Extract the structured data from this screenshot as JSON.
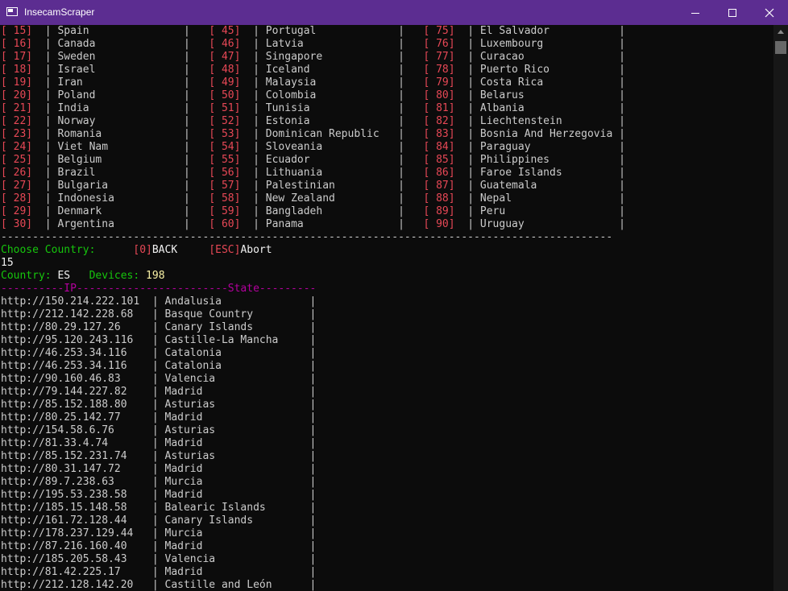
{
  "window": {
    "title": "InsecamScraper"
  },
  "countries": [
    [
      "15",
      "Spain",
      "45",
      "Portugal",
      "75",
      "El Salvador"
    ],
    [
      "16",
      "Canada",
      "46",
      "Latvia",
      "76",
      "Luxembourg"
    ],
    [
      "17",
      "Sweden",
      "47",
      "Singapore",
      "77",
      "Curacao"
    ],
    [
      "18",
      "Israel",
      "48",
      "Iceland",
      "78",
      "Puerto Rico"
    ],
    [
      "19",
      "Iran",
      "49",
      "Malaysia",
      "79",
      "Costa Rica"
    ],
    [
      "20",
      "Poland",
      "50",
      "Colombia",
      "80",
      "Belarus"
    ],
    [
      "21",
      "India",
      "51",
      "Tunisia",
      "81",
      "Albania"
    ],
    [
      "22",
      "Norway",
      "52",
      "Estonia",
      "82",
      "Liechtenstein"
    ],
    [
      "23",
      "Romania",
      "53",
      "Dominican Republic",
      "83",
      "Bosnia And Herzegovia"
    ],
    [
      "24",
      "Viet Nam",
      "54",
      "Sloveania",
      "84",
      "Paraguay"
    ],
    [
      "25",
      "Belgium",
      "55",
      "Ecuador",
      "85",
      "Philippines"
    ],
    [
      "26",
      "Brazil",
      "56",
      "Lithuania",
      "86",
      "Faroe Islands"
    ],
    [
      "27",
      "Bulgaria",
      "57",
      "Palestinian",
      "87",
      "Guatemala"
    ],
    [
      "28",
      "Indonesia",
      "58",
      "New Zealand",
      "88",
      "Nepal"
    ],
    [
      "29",
      "Denmark",
      "59",
      "Bangladeh",
      "89",
      "Peru"
    ],
    [
      "30",
      "Argentina",
      "60",
      "Panama",
      "90",
      "Uruguay"
    ]
  ],
  "separator": "-------------------------------------------------------------------------------------------------",
  "prompt": {
    "label": "Choose Country:",
    "back_key": "[0]",
    "back_label": "BACK",
    "abort_key": "[ESC]",
    "abort_label": "Abort"
  },
  "input_value": "15",
  "status": {
    "country_label": "Country:",
    "country_value": "ES",
    "devices_label": "Devices:",
    "devices_value": "198"
  },
  "results_header": {
    "prefix": "----------",
    "ip": "IP",
    "middle": "------------------------",
    "state": "State",
    "suffix": "---------"
  },
  "results": [
    [
      "http://150.214.222.101",
      "Andalusia"
    ],
    [
      "http://212.142.228.68",
      "Basque Country"
    ],
    [
      "http://80.29.127.26",
      "Canary Islands"
    ],
    [
      "http://95.120.243.116",
      "Castille-La Mancha"
    ],
    [
      "http://46.253.34.116",
      "Catalonia"
    ],
    [
      "http://46.253.34.116",
      "Catalonia"
    ],
    [
      "http://90.160.46.83",
      "Valencia"
    ],
    [
      "http://79.144.227.82",
      "Madrid"
    ],
    [
      "http://85.152.188.80",
      "Asturias"
    ],
    [
      "http://80.25.142.77",
      "Madrid"
    ],
    [
      "http://154.58.6.76",
      "Asturias"
    ],
    [
      "http://81.33.4.74",
      "Madrid"
    ],
    [
      "http://85.152.231.74",
      "Asturias"
    ],
    [
      "http://80.31.147.72",
      "Madrid"
    ],
    [
      "http://89.7.238.63",
      "Murcia"
    ],
    [
      "http://195.53.238.58",
      "Madrid"
    ],
    [
      "http://185.15.148.58",
      "Balearic Islands"
    ],
    [
      "http://161.72.128.44",
      "Canary Islands"
    ],
    [
      "http://178.237.129.44",
      "Murcia"
    ],
    [
      "http://87.216.160.40",
      "Madrid"
    ],
    [
      "http://185.205.58.43",
      "Valencia"
    ],
    [
      "http://81.42.225.17",
      "Madrid"
    ],
    [
      "http://212.128.142.20",
      "Castille and León"
    ]
  ],
  "icons": {
    "window": "console-icon",
    "minimize": "minimize-icon",
    "maximize": "maximize-icon",
    "close": "close-icon",
    "scroll_up": "chevron-up-icon"
  },
  "colors": {
    "titlebar": "#5c2d91",
    "background": "#0c0c0c",
    "text": "#cccccc",
    "number": "#e74856",
    "green": "#16c60c",
    "yellow": "#f9f1a5",
    "header": "#b4009e"
  }
}
